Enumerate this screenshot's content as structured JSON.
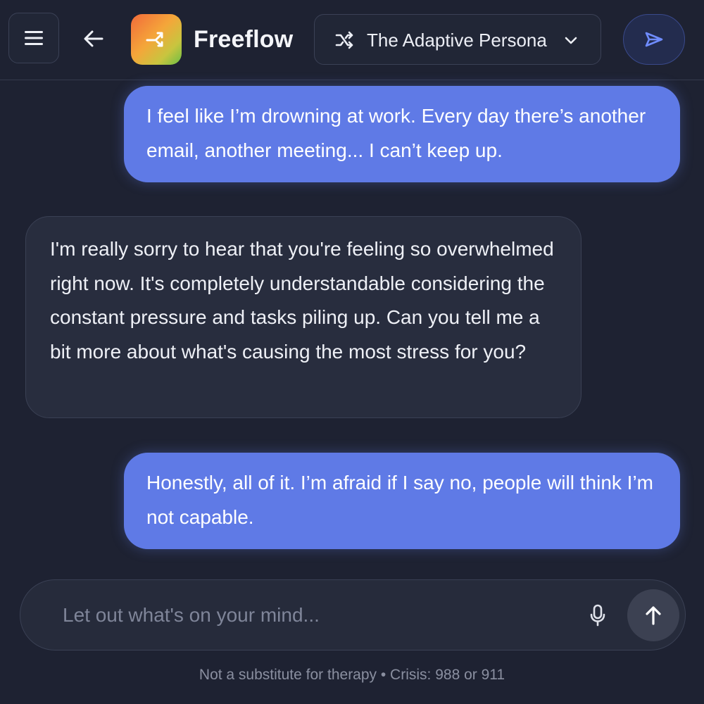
{
  "header": {
    "menu_icon": "hamburger-menu-icon",
    "back_icon": "arrow-left-icon",
    "logo_icon": "shuffle-arrow-icon",
    "app_title": "Freeflow",
    "persona": {
      "icon": "shuffle-icon",
      "label": "The Adaptive Persona",
      "chevron": "chevron-down-icon"
    },
    "send_icon": "paper-plane-icon"
  },
  "messages": [
    {
      "role": "user",
      "text": "I feel like I’m drowning at work. Every day there’s another email, another meeting... I can’t keep up."
    },
    {
      "role": "assistant",
      "text": "I'm really sorry to hear that you're feeling so overwhelmed right now. It's completely understandable considering the constant pressure and tasks piling up. Can you tell me a bit more about what's causing the most stress for you?"
    },
    {
      "role": "user",
      "text": "Honestly, all of it. I’m afraid if I say no, people will think I’m not capable."
    }
  ],
  "composer": {
    "placeholder": "Let out what's on your mind...",
    "value": "",
    "mic_icon": "microphone-icon",
    "send_icon": "arrow-up-icon"
  },
  "footer": {
    "disclaimer": "Not a substitute for therapy • Crisis: 988 or 911"
  },
  "colors": {
    "background": "#1e2232",
    "user_bubble": "#5f7ae6",
    "assistant_bubble": "#282d3e",
    "accent": "#5f7ae6"
  }
}
